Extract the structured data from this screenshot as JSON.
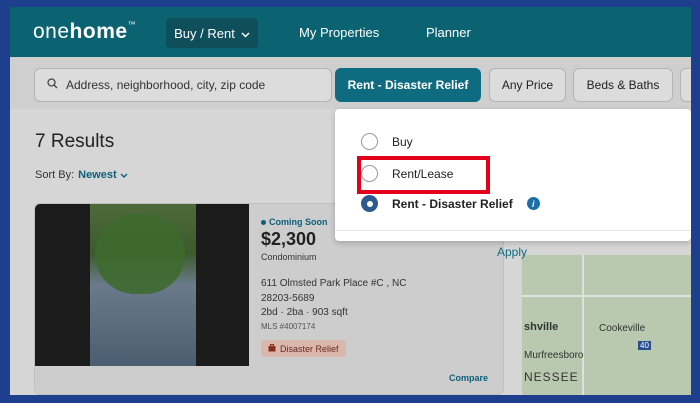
{
  "nav": {
    "logo_one": "one",
    "logo_home": "home",
    "logo_tm": "™",
    "buy_rent": "Buy / Rent",
    "my_properties": "My Properties",
    "planner": "Planner"
  },
  "search": {
    "placeholder": "Address, neighborhood, city, zip code"
  },
  "filters": {
    "type": "Rent - Disaster Relief",
    "price": "Any Price",
    "beds_baths": "Beds & Baths"
  },
  "results": {
    "title": "7 Results",
    "sort_label": "Sort By:",
    "sort_value": "Newest"
  },
  "listing": {
    "status": "Coming Soon",
    "price": "$2,300",
    "property_type": "Condominium",
    "address": "611 Olmsted Park Place #C , NC 28203-5689",
    "beds_baths": "2bd · 2ba · 903 sqft",
    "mls": "MLS #4007174",
    "badge": "Disaster Relief",
    "compare": "Compare"
  },
  "dropdown": {
    "options": [
      {
        "label": "Buy",
        "selected": false
      },
      {
        "label": "Rent/Lease",
        "selected": false
      },
      {
        "label": "Rent - Disaster Relief",
        "selected": true
      }
    ],
    "apply": "Apply"
  },
  "map": {
    "labels": [
      "shville",
      "Cookeville",
      "Murfreesboro",
      "NESSEE",
      "40"
    ]
  },
  "colors": {
    "brand": "#0b6372",
    "highlight": "#e3001b"
  }
}
